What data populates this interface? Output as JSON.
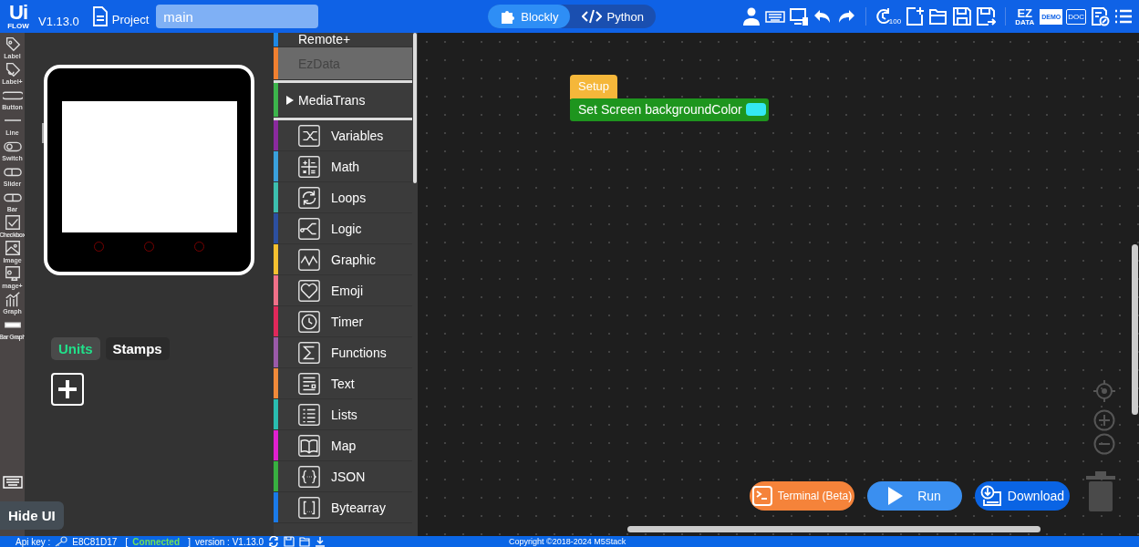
{
  "header": {
    "logo_top": "Ui",
    "logo_bottom": "FLOW",
    "version": "V1.13.0",
    "project_label": "Project",
    "file_name": "main",
    "history_badge": "100",
    "ez_top": "EZ",
    "ez_bottom": "DATA",
    "demo": "DEMO",
    "doc": "DOC",
    "modes": [
      {
        "label": "Blockly",
        "selected": true
      },
      {
        "label": "Python",
        "selected": false
      }
    ]
  },
  "widgets": [
    {
      "label": "Label"
    },
    {
      "label": "Label+"
    },
    {
      "label": "Button"
    },
    {
      "label": "Line"
    },
    {
      "label": "Switch"
    },
    {
      "label": "Slider"
    },
    {
      "label": "Bar"
    },
    {
      "label": "Checkbox"
    },
    {
      "label": "Image"
    },
    {
      "label": "mage+"
    },
    {
      "label": "Graph"
    },
    {
      "label": "Bar Graph"
    }
  ],
  "hide_ui": "Hide UI",
  "panel_tabs": [
    {
      "label": "Units",
      "selected": true
    },
    {
      "label": "Stamps",
      "selected": false
    }
  ],
  "categories": [
    {
      "label": "Remote+",
      "color": "#1e88e5",
      "kind": "plain",
      "disabled": false
    },
    {
      "label": "EzData",
      "color": "#f08030",
      "kind": "plain",
      "disabled": true
    },
    {
      "label": "MediaTrans",
      "color": "#3cb44b",
      "kind": "folder",
      "disabled": false,
      "expanded": false
    },
    {
      "label": "Variables",
      "color": "#8a2a9e",
      "kind": "icon",
      "disabled": false
    },
    {
      "label": "Math",
      "color": "#3aa0dc",
      "kind": "icon",
      "disabled": false
    },
    {
      "label": "Loops",
      "color": "#3cbfae",
      "kind": "icon",
      "disabled": false
    },
    {
      "label": "Logic",
      "color": "#2c4fa0",
      "kind": "icon",
      "disabled": false
    },
    {
      "label": "Graphic",
      "color": "#f5c030",
      "kind": "icon",
      "disabled": false
    },
    {
      "label": "Emoji",
      "color": "#f07088",
      "kind": "icon",
      "disabled": false
    },
    {
      "label": "Timer",
      "color": "#e0285a",
      "kind": "icon",
      "disabled": false
    },
    {
      "label": "Functions",
      "color": "#9a5aa8",
      "kind": "icon",
      "disabled": false
    },
    {
      "label": "Text",
      "color": "#f08a3a",
      "kind": "icon",
      "disabled": false
    },
    {
      "label": "Lists",
      "color": "#2abcb0",
      "kind": "icon",
      "disabled": false
    },
    {
      "label": "Map",
      "color": "#e020d0",
      "kind": "icon",
      "disabled": false
    },
    {
      "label": "JSON",
      "color": "#38b040",
      "kind": "icon",
      "disabled": false
    },
    {
      "label": "Bytearray",
      "color": "#1a7ae8",
      "kind": "icon",
      "disabled": false
    }
  ],
  "blocks": {
    "hat": "Setup",
    "statement": "Set Screen backgroundColor"
  },
  "actions": [
    {
      "label": "Terminal (Beta)",
      "kind": "terminal"
    },
    {
      "label": "Run",
      "kind": "run"
    },
    {
      "label": "Download",
      "kind": "download"
    }
  ],
  "status_bar": {
    "api_label": "Api key :",
    "api_key": "E8C81D17",
    "bracket_open": "[",
    "connection": "Connected",
    "connected": true,
    "bracket_close": "]",
    "version": "version : V1.13.0",
    "copyright": "Copyright ©2018-2024 M5Stack"
  }
}
